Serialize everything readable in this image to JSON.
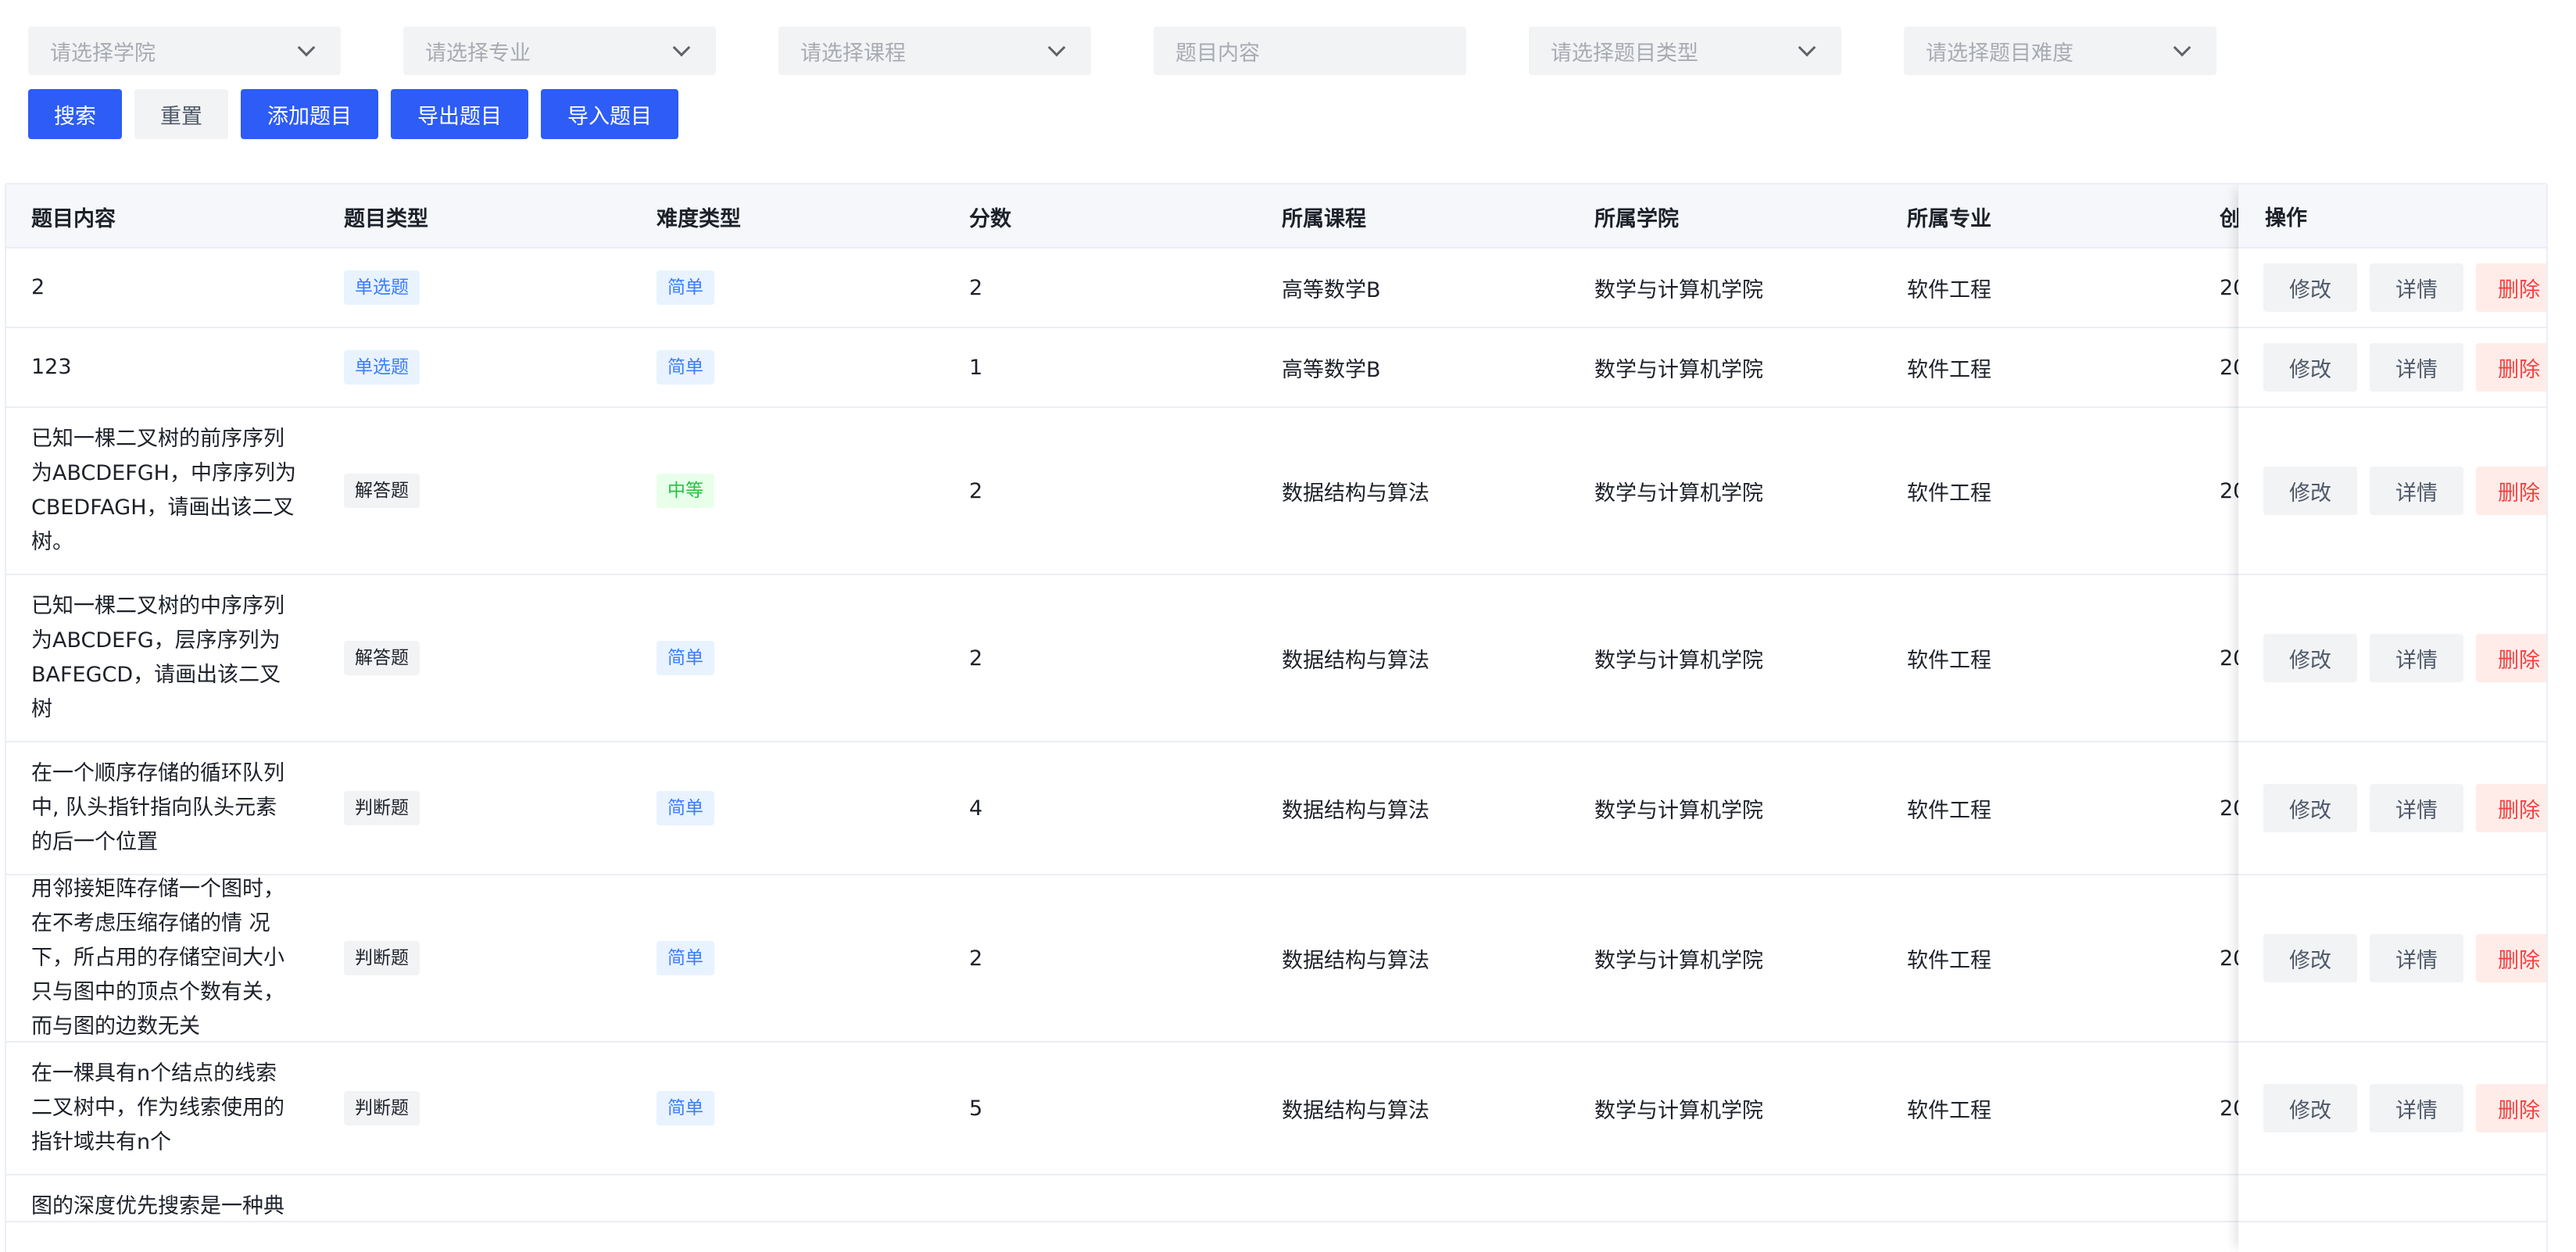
{
  "filters": [
    {
      "placeholder": "请选择学院",
      "type": "select"
    },
    {
      "placeholder": "请选择专业",
      "type": "select"
    },
    {
      "placeholder": "请选择课程",
      "type": "select"
    },
    {
      "placeholder": "题目内容",
      "type": "input"
    },
    {
      "placeholder": "请选择题目类型",
      "type": "select"
    },
    {
      "placeholder": "请选择题目难度",
      "type": "select"
    }
  ],
  "buttons": {
    "search": "搜索",
    "reset": "重置",
    "add": "添加题目",
    "export": "导出题目",
    "import": "导入题目"
  },
  "table": {
    "headers": [
      "题目内容",
      "题目类型",
      "难度类型",
      "分数",
      "所属课程",
      "所属学院",
      "所属专业",
      "创",
      "操作"
    ],
    "action_labels": {
      "edit": "修改",
      "detail": "详情",
      "delete": "删除"
    },
    "rows": [
      {
        "content": "2",
        "type": "单选题",
        "difficulty": "简单",
        "score": "2",
        "course": "高等数学B",
        "college": "数学与计算机学院",
        "major": "软件工程",
        "created": "20"
      },
      {
        "content": "123",
        "type": "单选题",
        "difficulty": "简单",
        "score": "1",
        "course": "高等数学B",
        "college": "数学与计算机学院",
        "major": "软件工程",
        "created": "20"
      },
      {
        "content": "已知一棵二叉树的前序序列为ABCDEFGH，中序序列为CBEDFAGH，请画出该二叉树。",
        "type": "解答题",
        "difficulty": "中等",
        "score": "2",
        "course": "数据结构与算法",
        "college": "数学与计算机学院",
        "major": "软件工程",
        "created": "20"
      },
      {
        "content": "已知一棵二叉树的中序序列为ABCDEFG，层序序列为BAFEGCD，请画出该二叉树",
        "type": "解答题",
        "difficulty": "简单",
        "score": "2",
        "course": "数据结构与算法",
        "college": "数学与计算机学院",
        "major": "软件工程",
        "created": "20"
      },
      {
        "content": "在一个顺序存储的循环队列中, 队头指针指向队头元素的后一个位置",
        "type": "判断题",
        "difficulty": "简单",
        "score": "4",
        "course": "数据结构与算法",
        "college": "数学与计算机学院",
        "major": "软件工程",
        "created": "20"
      },
      {
        "content": "用邻接矩阵存储一个图时，在不考虑压缩存储的情 况下，所占用的存储空间大小只与图中的顶点个数有关，而与图的边数无关",
        "type": "判断题",
        "difficulty": "简单",
        "score": "2",
        "course": "数据结构与算法",
        "college": "数学与计算机学院",
        "major": "软件工程",
        "created": "20"
      },
      {
        "content": "在一棵具有n个结点的线索二叉树中，作为线索使用的指针域共有n个",
        "type": "判断题",
        "difficulty": "简单",
        "score": "5",
        "course": "数据结构与算法",
        "college": "数学与计算机学院",
        "major": "软件工程",
        "created": "20"
      },
      {
        "content": "图的深度优先搜索是一种典",
        "type": "",
        "difficulty": "",
        "score": "",
        "course": "",
        "college": "",
        "major": "",
        "created": ""
      }
    ]
  },
  "colors": {
    "primary": "#2d5cf6",
    "tag_blue_text": "#3c7cff",
    "tag_green_text": "#23c343",
    "danger": "#f53f3f"
  }
}
